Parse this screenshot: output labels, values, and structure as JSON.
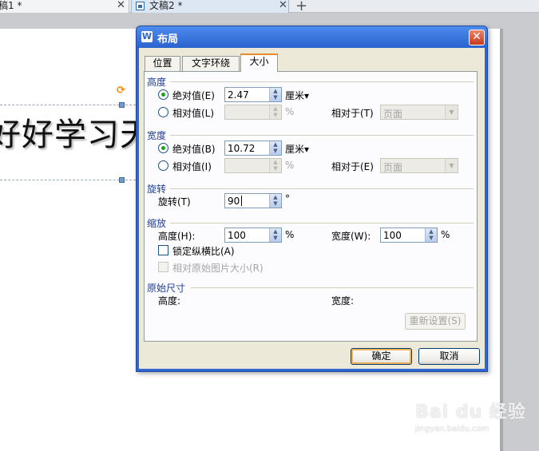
{
  "tabs": [
    {
      "label": "稿1 *",
      "close": "✕"
    },
    {
      "label": "文稿2 *",
      "close": "✕"
    }
  ],
  "new_tab": "+",
  "document": {
    "visible_text": "好好学习天"
  },
  "dialog": {
    "title": "布局",
    "close": "✕",
    "tabs": [
      {
        "label": "位置",
        "active": false
      },
      {
        "label": "文字环绕",
        "active": false
      },
      {
        "label": "大小",
        "active": true
      }
    ],
    "height": {
      "title": "高度",
      "absolute": {
        "label": "绝对值(E)",
        "value": "2.47",
        "unit": "厘米▾",
        "checked": true
      },
      "relative": {
        "label": "相对值(L)",
        "unit": "%",
        "relative_to_label": "相对于(T)",
        "relative_to_value": "页面",
        "checked": false
      }
    },
    "width": {
      "title": "宽度",
      "absolute": {
        "label": "绝对值(B)",
        "value": "10.72",
        "unit": "厘米▾",
        "checked": true
      },
      "relative": {
        "label": "相对值(I)",
        "unit": "%",
        "relative_to_label": "相对于(E)",
        "relative_to_value": "页面",
        "checked": false
      }
    },
    "rotate": {
      "title": "旋转",
      "label": "旋转(T)",
      "value": "90",
      "unit": "°"
    },
    "scale": {
      "title": "缩放",
      "height_label": "高度(H):",
      "height_value": "100",
      "width_label": "宽度(W):",
      "width_value": "100",
      "unit": "%",
      "lock_ratio": {
        "label": "锁定纵横比(A)",
        "checked": false
      },
      "relative_original": {
        "label": "相对原始图片大小(R)",
        "checked": false,
        "enabled": false
      }
    },
    "original": {
      "title": "原始尺寸",
      "height_label": "高度:",
      "width_label": "宽度:",
      "reset": "重新设置(S)"
    },
    "ok": "确定",
    "cancel": "取消"
  },
  "watermark": {
    "logo": "Bai du 经验",
    "url": "jingyan.baidu.com"
  }
}
